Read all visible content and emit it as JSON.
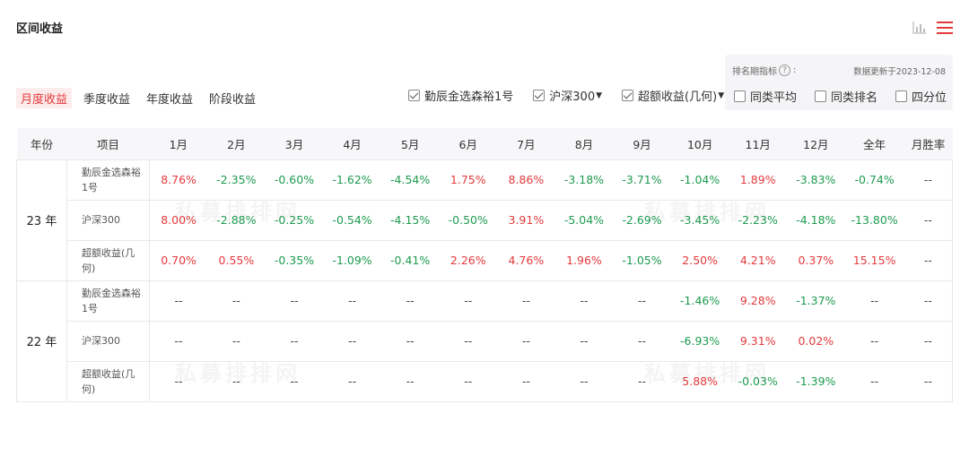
{
  "title": "区间收益",
  "tabs": [
    {
      "label": "月度收益",
      "active": true
    },
    {
      "label": "季度收益",
      "active": false
    },
    {
      "label": "年度收益",
      "active": false
    },
    {
      "label": "阶段收益",
      "active": false
    }
  ],
  "series_checks": [
    {
      "label": "勤辰金选森裕1号",
      "checked": true,
      "dropdown": false
    },
    {
      "label": "沪深300",
      "checked": true,
      "dropdown": true
    },
    {
      "label": "超额收益(几何)",
      "checked": true,
      "dropdown": true
    }
  ],
  "rank_panel": {
    "label": "排名期指标",
    "help": "?",
    "suffix": ":",
    "update_text": "数据更新于2023-12-08",
    "checks": [
      {
        "label": "同类平均",
        "checked": false
      },
      {
        "label": "同类排名",
        "checked": false
      },
      {
        "label": "四分位",
        "checked": false
      }
    ]
  },
  "watermark": "私募排排网",
  "table": {
    "headers": [
      "年份",
      "项目",
      "1月",
      "2月",
      "3月",
      "4月",
      "5月",
      "6月",
      "7月",
      "8月",
      "9月",
      "10月",
      "11月",
      "12月",
      "全年",
      "月胜率"
    ],
    "groups": [
      {
        "year": "23 年",
        "rows": [
          {
            "item": "勤辰金选森裕1号",
            "cells": [
              "8.76%",
              "-2.35%",
              "-0.60%",
              "-1.62%",
              "-4.54%",
              "1.75%",
              "8.86%",
              "-3.18%",
              "-3.71%",
              "-1.04%",
              "1.89%",
              "-3.83%",
              "-0.74%",
              "--"
            ]
          },
          {
            "item": "沪深300",
            "cells": [
              "8.00%",
              "-2.88%",
              "-0.25%",
              "-0.54%",
              "-4.15%",
              "-0.50%",
              "3.91%",
              "-5.04%",
              "-2.69%",
              "-3.45%",
              "-2.23%",
              "-4.18%",
              "-13.80%",
              "--"
            ]
          },
          {
            "item": "超额收益(几何)",
            "cells": [
              "0.70%",
              "0.55%",
              "-0.35%",
              "-1.09%",
              "-0.41%",
              "2.26%",
              "4.76%",
              "1.96%",
              "-1.05%",
              "2.50%",
              "4.21%",
              "0.37%",
              "15.15%",
              "--"
            ]
          }
        ]
      },
      {
        "year": "22 年",
        "rows": [
          {
            "item": "勤辰金选森裕1号",
            "cells": [
              "--",
              "--",
              "--",
              "--",
              "--",
              "--",
              "--",
              "--",
              "--",
              "-1.46%",
              "9.28%",
              "-1.37%",
              "--",
              "--"
            ]
          },
          {
            "item": "沪深300",
            "cells": [
              "--",
              "--",
              "--",
              "--",
              "--",
              "--",
              "--",
              "--",
              "--",
              "-6.93%",
              "9.31%",
              "0.02%",
              "--",
              "--"
            ]
          },
          {
            "item": "超额收益(几何)",
            "cells": [
              "--",
              "--",
              "--",
              "--",
              "--",
              "--",
              "--",
              "--",
              "--",
              "5.88%",
              "-0.03%",
              "-1.39%",
              "--",
              "--"
            ]
          }
        ]
      }
    ]
  },
  "colors": {
    "positive": "#e4393c",
    "negative": "#1d9b4f",
    "accent": "#e4393c"
  },
  "icons": {
    "chart": "bar-chart-icon",
    "list": "list-icon"
  }
}
